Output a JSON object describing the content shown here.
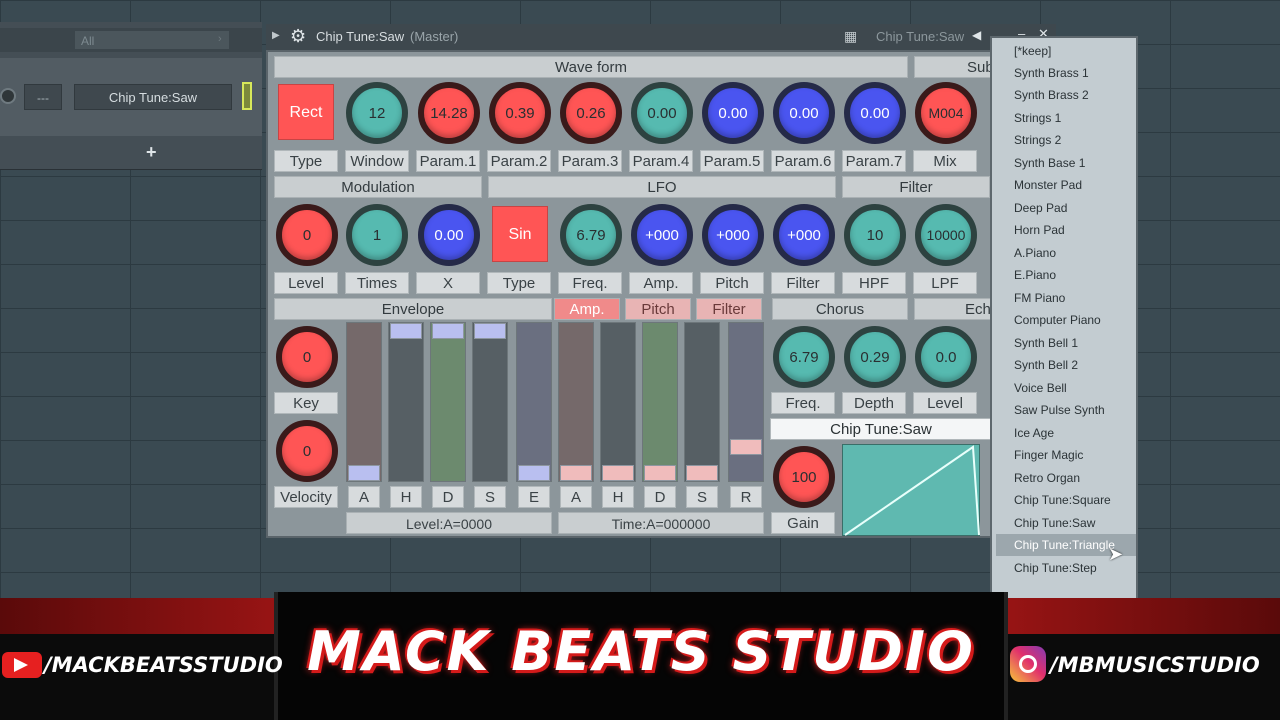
{
  "channel_rack": {
    "filter": "All",
    "mixer_track": "---",
    "channel_name": "Chip Tune:Saw",
    "add": "+"
  },
  "plugin": {
    "title": "Chip Tune:Saw",
    "subtitle": "(Master)",
    "preset_name": "Chip Tune:Saw",
    "sections": {
      "waveform": "Wave form",
      "sub": "Sub",
      "modulation": "Modulation",
      "lfo": "LFO",
      "filter": "Filter",
      "envelope": "Envelope",
      "amp": "Amp.",
      "pitch": "Pitch",
      "filter_tab": "Filter",
      "chorus": "Chorus",
      "echo": "Ech"
    },
    "wave_row": {
      "type_value": "Rect",
      "knobs": [
        "12",
        "14.28",
        "0.39",
        "0.26",
        "0.00",
        "0.00",
        "0.00",
        "0.00",
        "M004"
      ],
      "labels": [
        "Type",
        "Window",
        "Param.1",
        "Param.2",
        "Param.3",
        "Param.4",
        "Param.5",
        "Param.6",
        "Param.7",
        "Mix"
      ]
    },
    "mod_row": {
      "knobs": [
        "0",
        "1",
        "0.00"
      ],
      "lfo_type": "Sin",
      "lfo_knobs": [
        "6.79",
        "+000",
        "+000",
        "+000"
      ],
      "filter_knobs": [
        "10",
        "10000"
      ],
      "labels": [
        "Level",
        "Times",
        "X",
        "Type",
        "Freq.",
        "Amp.",
        "Pitch",
        "Filter",
        "HPF",
        "LPF"
      ]
    },
    "env_row": {
      "key_knob": "0",
      "velocity_knob": "0",
      "key_label": "Key",
      "velocity_label": "Velocity",
      "fader_labels": [
        "A",
        "H",
        "D",
        "S",
        "E",
        "A",
        "H",
        "D",
        "S",
        "R"
      ],
      "level_readout": "Level:A=0000",
      "time_readout": "Time:A=000000",
      "chorus_knobs": [
        "6.79",
        "0.29",
        "0.0"
      ],
      "chorus_labels": [
        "Freq.",
        "Depth",
        "Level"
      ],
      "gain_knob": "100",
      "gain_label": "Gain",
      "preset_display": "Chip Tune:Saw"
    }
  },
  "preset_menu": {
    "items": [
      "[*keep]",
      "Synth Brass 1",
      "Synth Brass 2",
      "Strings 1",
      "Strings 2",
      "Synth Base 1",
      "Monster Pad",
      "Deep Pad",
      "Horn Pad",
      "A.Piano",
      "E.Piano",
      "FM Piano",
      "Computer Piano",
      "Synth Bell 1",
      "Synth Bell 2",
      "Voice Bell",
      "Saw Pulse Synth",
      "Ice Age",
      "Finger Magic",
      "Retro Organ",
      "Chip Tune:Square",
      "Chip Tune:Saw",
      "Chip Tune:Triangle",
      "Chip Tune:Step"
    ],
    "highlighted": "Chip Tune:Triangle"
  },
  "banner": {
    "brand": "MACK BEATS STUDIO",
    "youtube": "/MACKBEATSSTUDIO",
    "instagram": "/MBMUSICSTUDIO"
  }
}
